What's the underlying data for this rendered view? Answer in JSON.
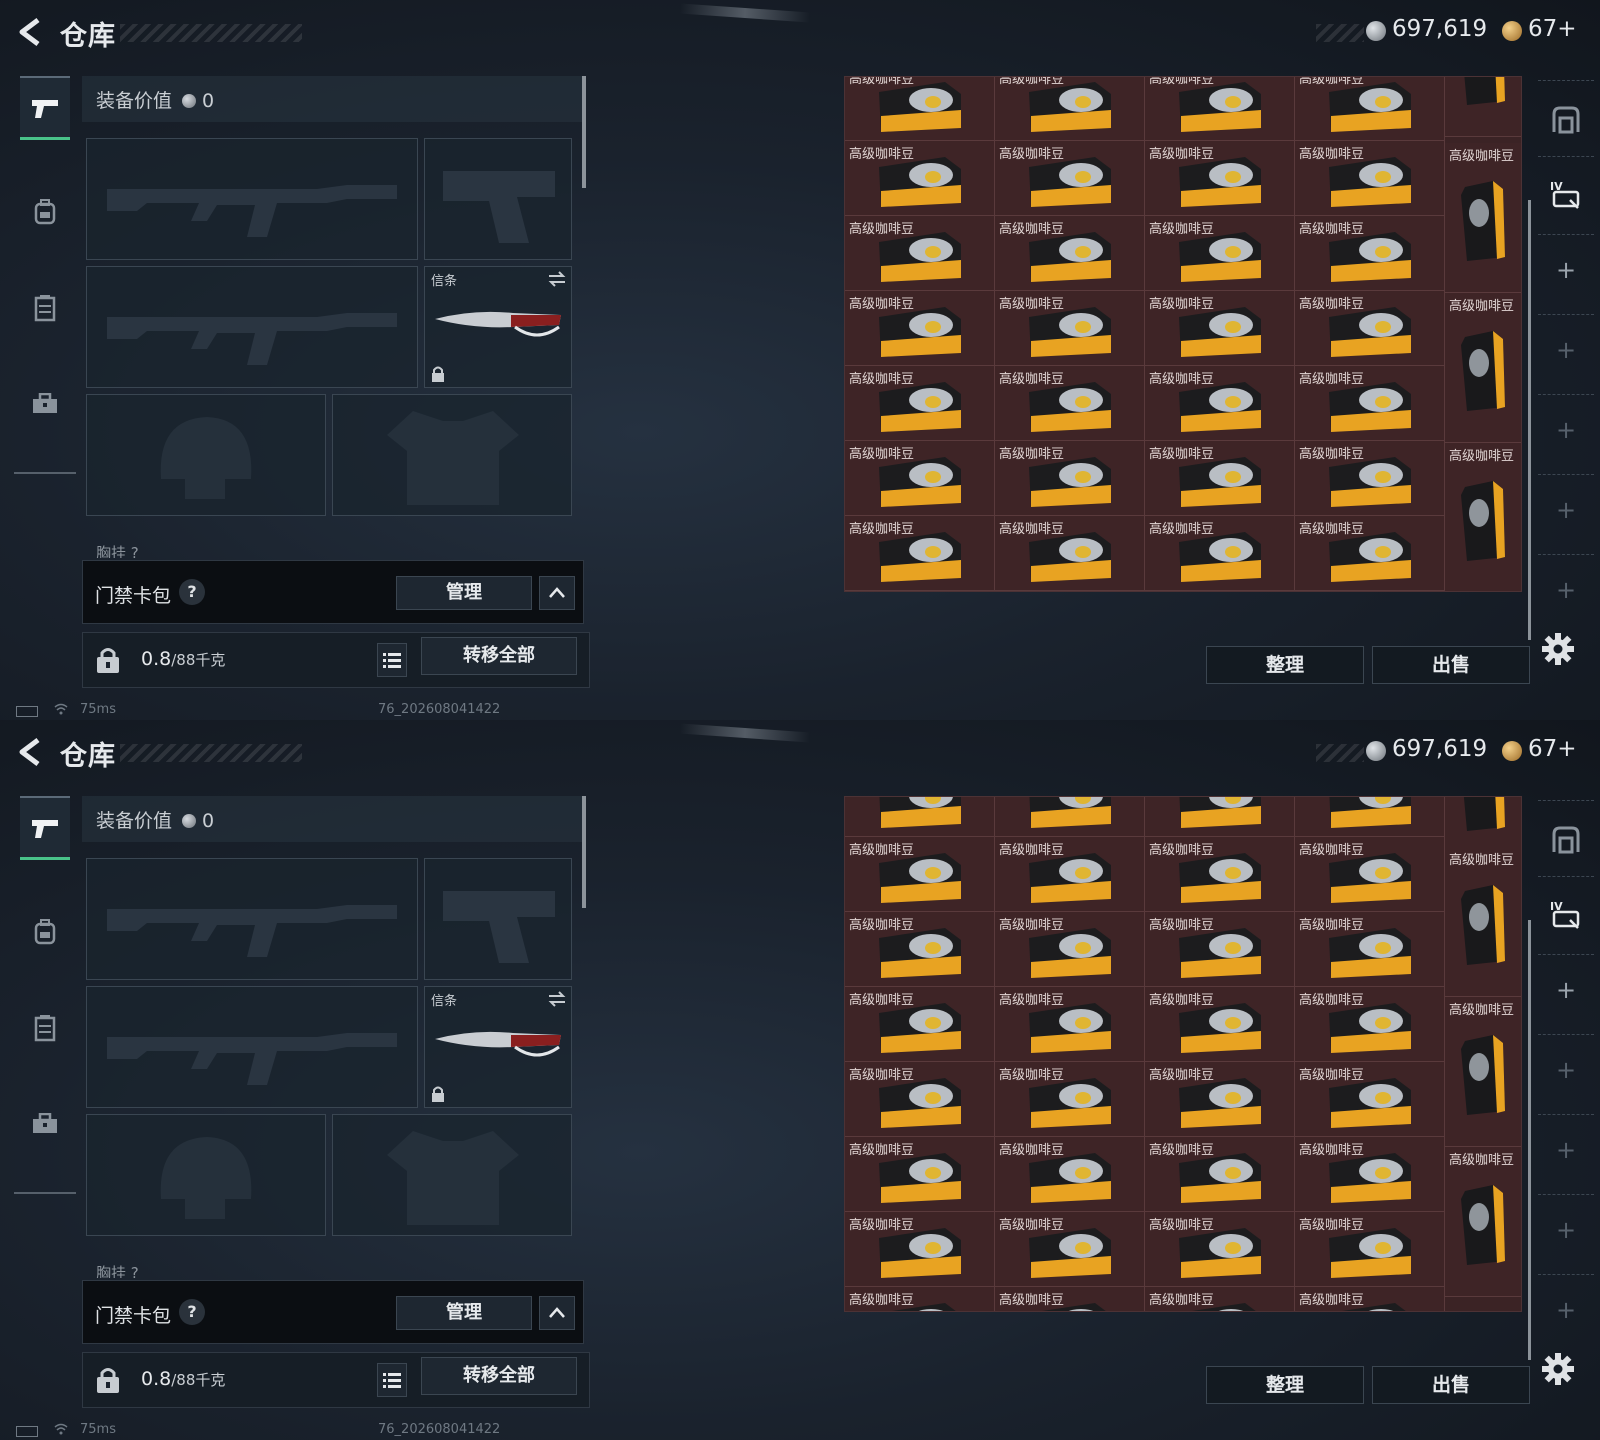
{
  "panels": [
    {
      "header": {
        "title": "仓库",
        "silver_amount": "697,619",
        "gold_amount": "67+"
      },
      "equipment": {
        "value_label": "装备价值",
        "value_amount": "0",
        "melee_slot_label": "信条",
        "chest_label": "胸挂 ?",
        "keycard_label": "门禁卡包",
        "keycard_help": "?",
        "manage_button": "管理",
        "weight_value": "0.8",
        "weight_capacity": "/88千克",
        "transfer_all_button": "转移全部"
      },
      "stash": {
        "item_name": "高级咖啡豆",
        "organize_button": "整理",
        "sell_button": "出售"
      },
      "status": {
        "ping": "75ms",
        "build": "76_202608041422"
      }
    },
    {
      "header": {
        "title": "仓库",
        "silver_amount": "697,619",
        "gold_amount": "67+"
      },
      "equipment": {
        "value_label": "装备价值",
        "value_amount": "0",
        "melee_slot_label": "信条",
        "chest_label": "胸挂 ?",
        "keycard_label": "门禁卡包",
        "keycard_help": "?",
        "manage_button": "管理",
        "weight_value": "0.8",
        "weight_capacity": "/88千克",
        "transfer_all_button": "转移全部"
      },
      "stash": {
        "item_name": "高级咖啡豆",
        "organize_button": "整理",
        "sell_button": "出售"
      },
      "status": {
        "ping": "75ms",
        "build": "76_202608041422"
      }
    }
  ],
  "colors": {
    "accent_green": "#49c38a",
    "stash_bg": "#3b2325",
    "coffee_orange": "#e8a322"
  },
  "icons": {
    "back": "back-arrow-icon",
    "silver_coin": "silver-coin-icon",
    "gold_coin": "gold-coin-icon",
    "nav": [
      "pistol-icon",
      "backpack-icon",
      "vest-icon",
      "briefcase-icon"
    ],
    "rail": [
      "safe-box-icon",
      "tier4-item-icon",
      "plus-icon"
    ],
    "settings": "gear-icon"
  }
}
